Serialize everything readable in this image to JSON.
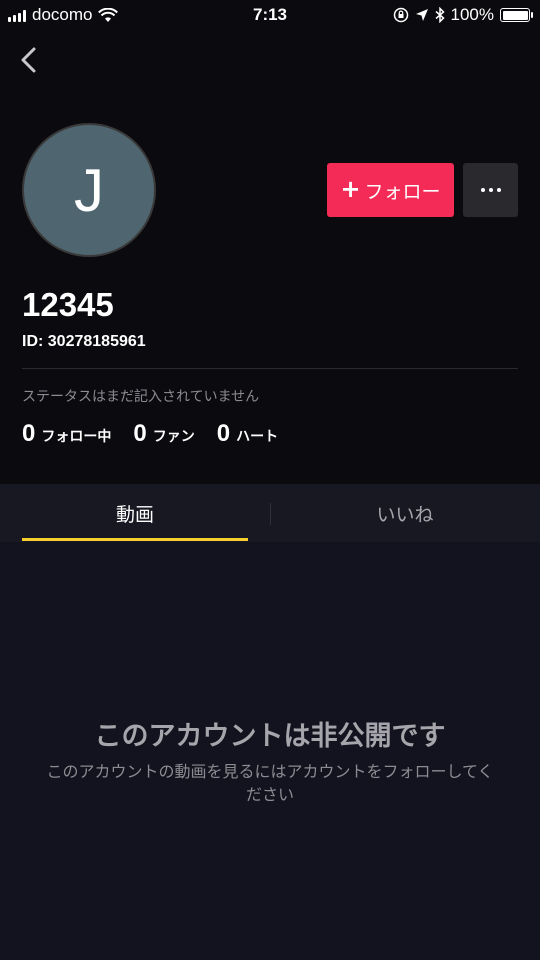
{
  "status_bar": {
    "carrier": "docomo",
    "time": "7:13",
    "battery": "100%",
    "battery_level": 1.0
  },
  "profile": {
    "avatar_initial": "J",
    "follow_label": "フォロー",
    "username": "12345",
    "id_text": "ID: 30278185961",
    "bio": "ステータスはまだ記入されていません",
    "stats": [
      {
        "count": "0",
        "label": "フォロー中"
      },
      {
        "count": "0",
        "label": "ファン"
      },
      {
        "count": "0",
        "label": "ハート"
      }
    ]
  },
  "tabs": [
    {
      "label": "動画"
    },
    {
      "label": "いいね"
    }
  ],
  "empty_state": {
    "title": "このアカウントは非公開です",
    "description": "このアカウントの動画を見るにはアカウントをフォローしてください"
  },
  "colors": {
    "background": "#0b0a0e",
    "follow_button": "#f42b56",
    "tab_indicator": "#f6cf2f",
    "avatar": "#4f6671"
  }
}
